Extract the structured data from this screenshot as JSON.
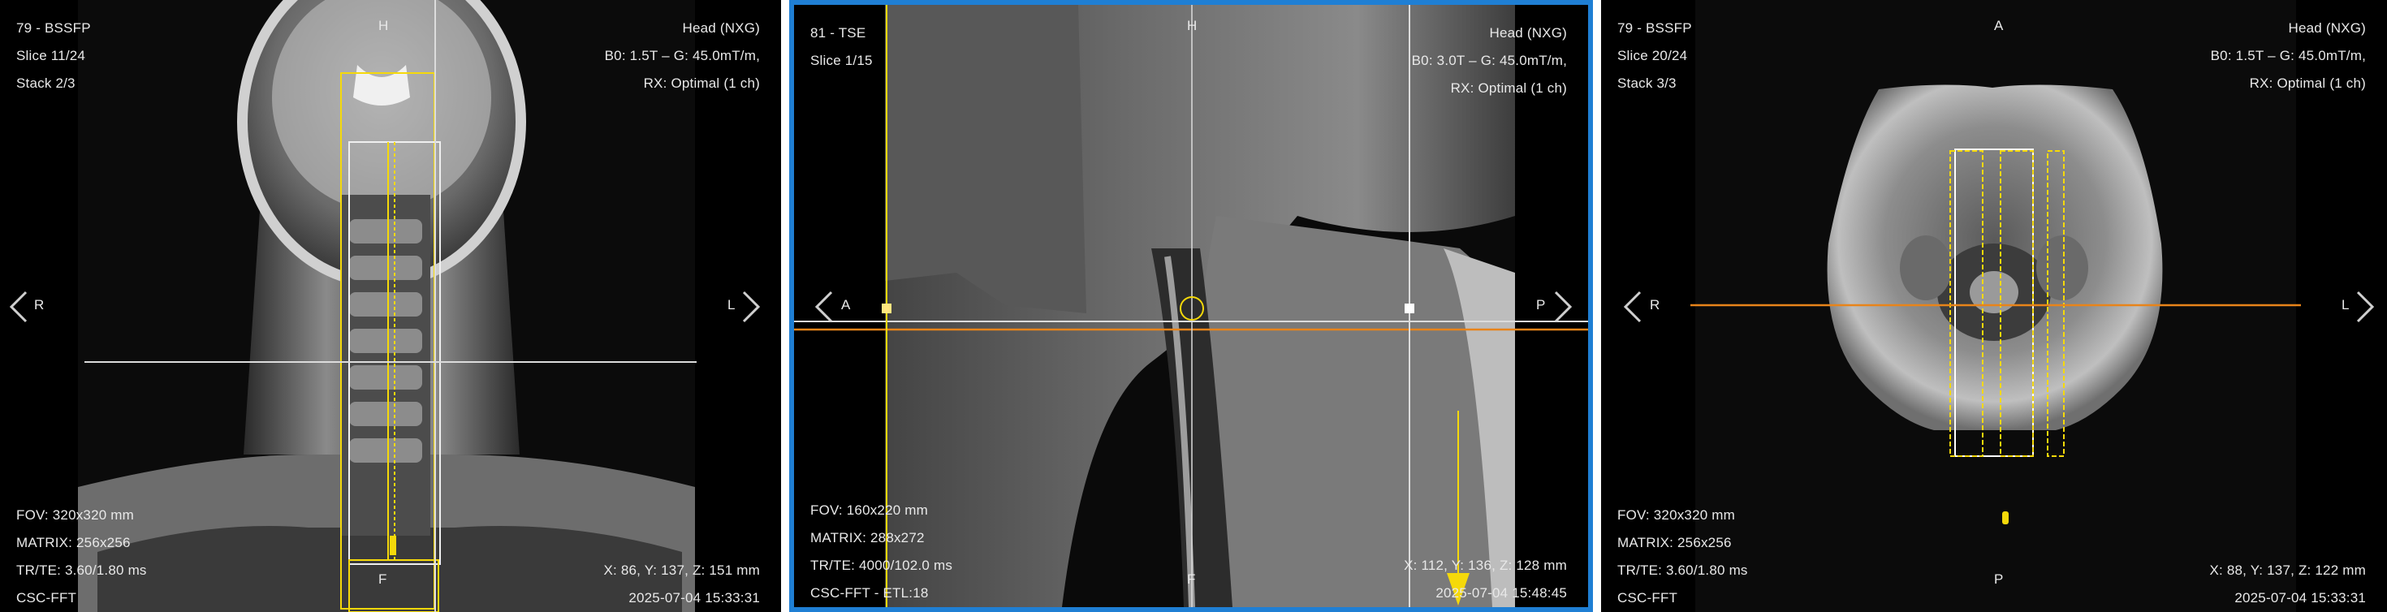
{
  "viewports": [
    {
      "series": "79 - BSSFP",
      "slice": "Slice 11/24",
      "stack": "Stack 2/3",
      "coil": "Head (NXG)",
      "field": "B0: 1.5T – G: 45.0mT/m,",
      "rx": "RX: Optimal (1 ch)",
      "fov": "FOV: 320x320 mm",
      "matrix": "MATRIX: 256x256",
      "trte": "TR/TE: 3.60/1.80 ms",
      "recon": "CSC-FFT",
      "coords": "X: 86, Y: 137, Z: 151 mm",
      "timestamp": "2025-07-04 15:33:31",
      "ori_top": "H",
      "ori_bottom": "F",
      "ori_left": "R",
      "ori_right": "L"
    },
    {
      "series": "81 - TSE",
      "slice": "Slice 1/15",
      "coil": "Head (NXG)",
      "field": "B0: 3.0T – G: 45.0mT/m,",
      "rx": "RX: Optimal (1 ch)",
      "fov": "FOV: 160x220 mm",
      "matrix": "MATRIX: 288x272",
      "trte": "TR/TE: 4000/102.0 ms",
      "recon": "CSC-FFT - ETL:18",
      "coords": "X: 112, Y: 136, Z: 128 mm",
      "timestamp": "2025-07-04 15:48:45",
      "ori_top": "H",
      "ori_bottom": "F",
      "ori_left": "A",
      "ori_right": "P"
    },
    {
      "series": "79 - BSSFP",
      "slice": "Slice 20/24",
      "stack": "Stack 3/3",
      "coil": "Head (NXG)",
      "field": "B0: 1.5T – G: 45.0mT/m,",
      "rx": "RX: Optimal (1 ch)",
      "fov": "FOV: 320x320 mm",
      "matrix": "MATRIX: 256x256",
      "trte": "TR/TE: 3.60/1.80 ms",
      "recon": "CSC-FFT",
      "coords": "X: 88, Y: 137, Z: 122 mm",
      "timestamp": "2025-07-04 15:33:31",
      "ori_top": "A",
      "ori_bottom": "P",
      "ori_left": "R",
      "ori_right": "L"
    }
  ],
  "colors": {
    "active_border": "#1f7fd4",
    "slice_lines": "#f5d90a",
    "reference_line": "#e8841a",
    "crosshair": "#dcdcdc"
  },
  "icons": [
    "chevron-left-icon",
    "chevron-right-icon",
    "slice-direction-arrow-icon"
  ]
}
